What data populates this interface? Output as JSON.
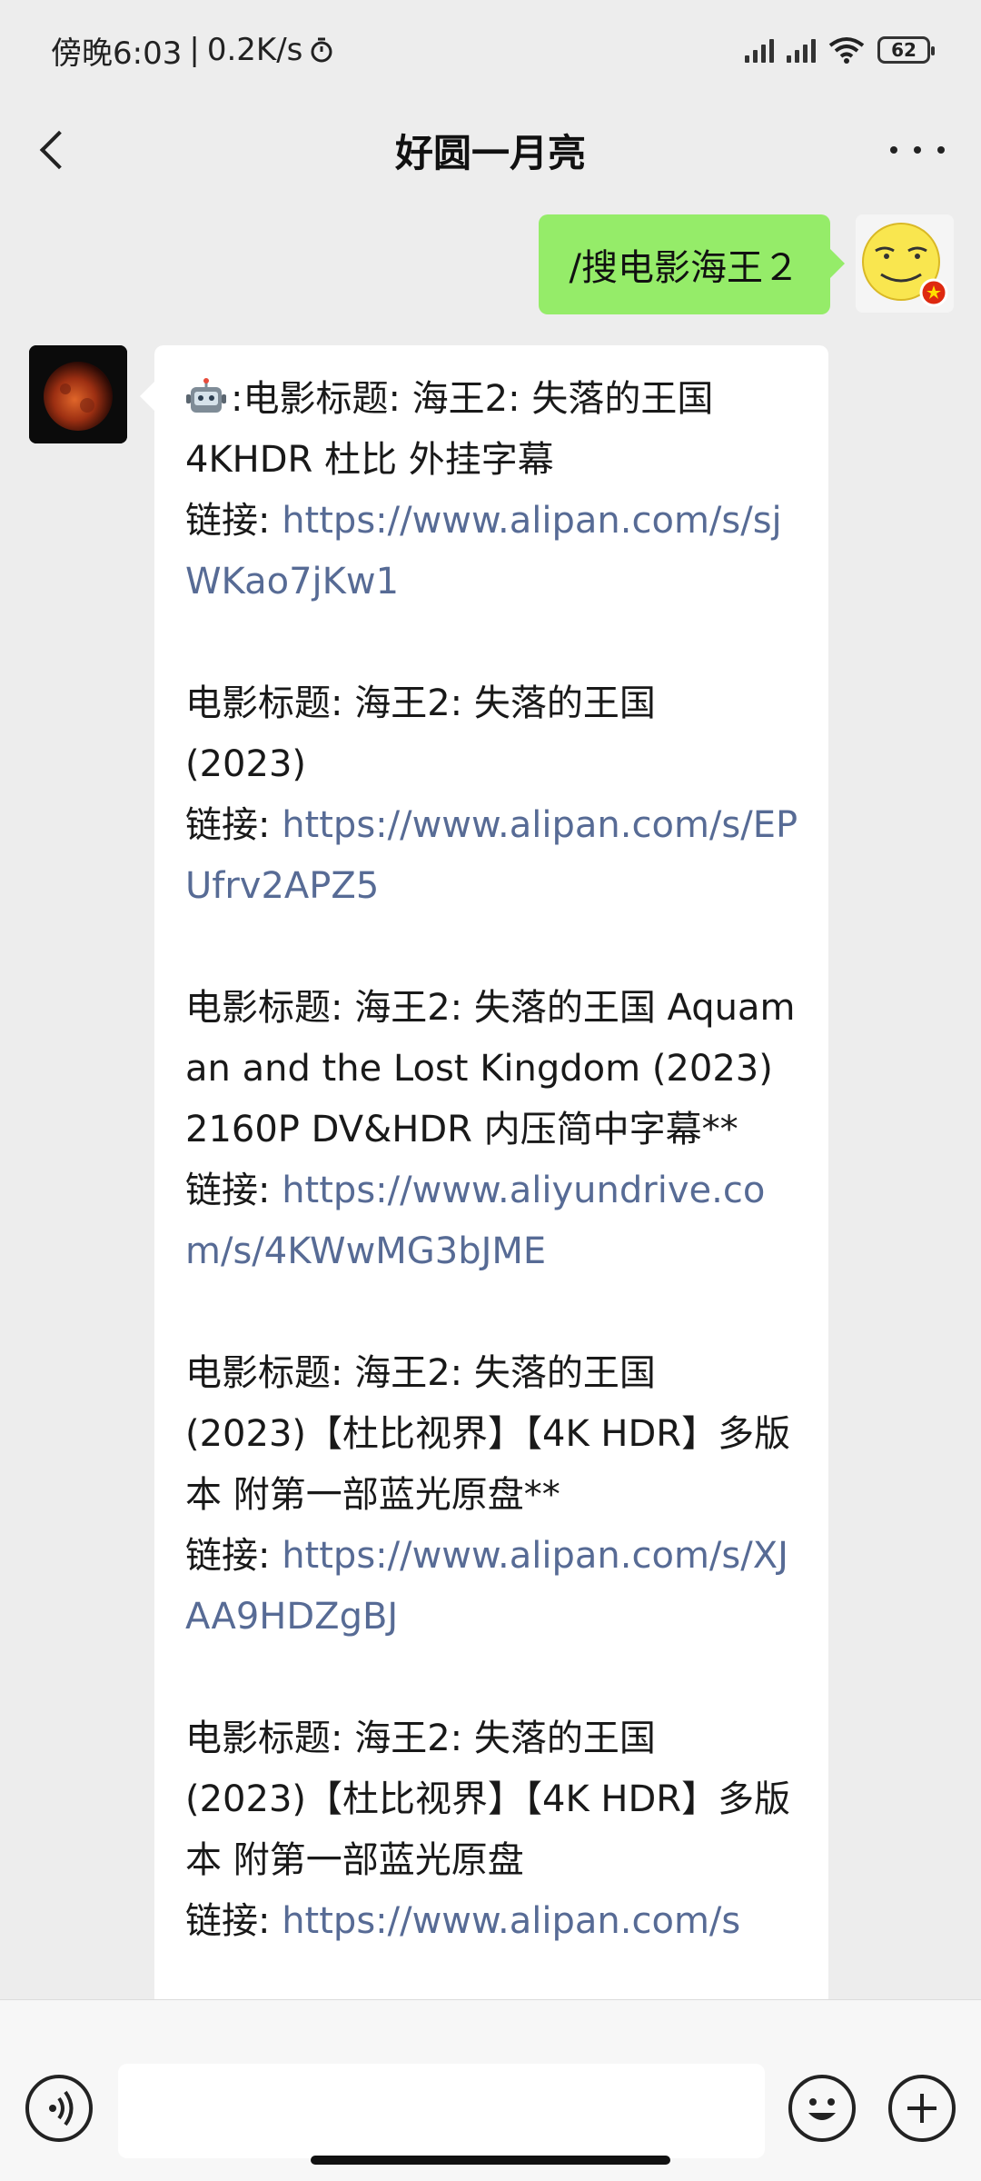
{
  "status_bar": {
    "time": "傍晚6:03",
    "separator": "|",
    "speed": "0.2K/s",
    "battery": "62",
    "icons": [
      "alarm-icon",
      "signal-icon",
      "signal-icon",
      "wifi-icon",
      "battery-icon"
    ]
  },
  "header": {
    "title": "好圆一月亮",
    "back_icon": "chevron-left-icon",
    "more_icon": "more-dots-icon"
  },
  "messages": {
    "sent": {
      "text": "/搜电影海王２"
    },
    "reply": {
      "entries": [
        {
          "prefix": ":",
          "title_line_1": "电影标题: 海王2: 失落的王国",
          "title_line_2": "4KHDR 杜比 外挂字幕",
          "link_label": "链接: ",
          "url": "https://www.alipan.com/s/sjWKao7jKw1"
        },
        {
          "title_line_1": "电影标题: 海王2: 失落的王国",
          "title_line_2": "(2023)",
          "link_label": "链接: ",
          "url": "https://www.alipan.com/s/EPUfrv2APZ5"
        },
        {
          "title_line_1": "电影标题: 海王2: 失落的王国 Aquaman and the Lost Kingdom (2023) 2160P DV&HDR 内压简中字幕**",
          "link_label": "链接: ",
          "url": "https://www.aliyundrive.com/s/4KWwMG3bJME"
        },
        {
          "title_line_1": "电影标题: 海王2: 失落的王国",
          "title_line_2": "(2023)【杜比视界】【4K HDR】多版本 附第一部蓝光原盘**",
          "link_label": "链接: ",
          "url": "https://www.alipan.com/s/XJAA9HDZgBJ"
        },
        {
          "title_line_1": "电影标题: 海王2: 失落的王国",
          "title_line_2": "(2023)【杜比视界】【4K HDR】多版本 附第一部蓝光原盘",
          "link_label": "链接: ",
          "url": "https://www.alipan.com/s"
        }
      ]
    }
  },
  "input_bar": {
    "voice_icon": "voice-icon",
    "emoji_icon": "emoji-icon",
    "add_icon": "plus-icon",
    "placeholder": ""
  },
  "colors": {
    "background": "#ededed",
    "sent_bubble": "#95ec69",
    "link": "#576b95"
  }
}
